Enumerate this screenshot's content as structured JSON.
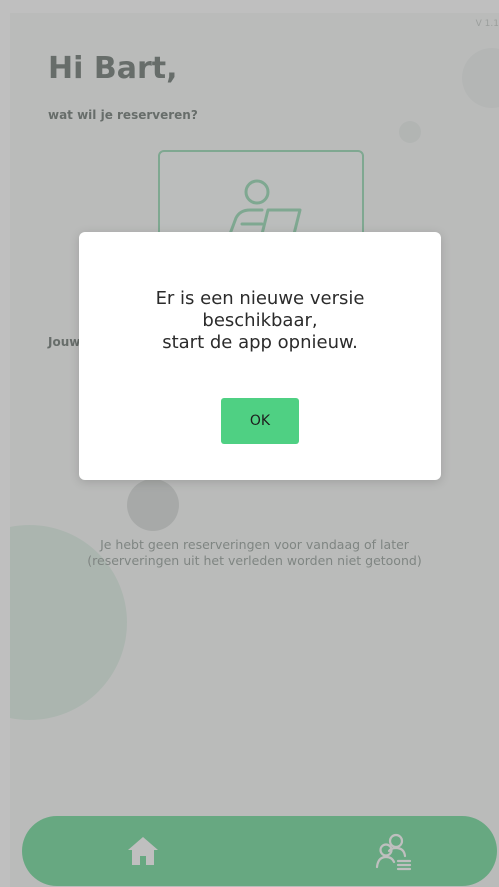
{
  "app": {
    "version": "V 1.1",
    "greeting": "Hi Bart,",
    "subtitle": "wat wil je reserveren?",
    "section_label": "Jouw",
    "empty_message": {
      "line1": "Je hebt geen reserveringen voor vandaag of later",
      "line2": "(reserveringen uit het verleden worden niet getoond)"
    }
  },
  "nav": {
    "items": [
      {
        "icon": "home-icon"
      },
      {
        "icon": "people-list-icon"
      }
    ]
  },
  "dialog": {
    "message_lines": [
      "Er is een nieuwe versie",
      "beschikbaar,",
      "start de app opnieuw."
    ],
    "ok_label": "OK"
  },
  "colors": {
    "accent": "#4fd083",
    "card_border": "#7fd1a3",
    "text_dark": "#4f5a55",
    "overlay": "rgba(128,128,128,0.5)"
  }
}
